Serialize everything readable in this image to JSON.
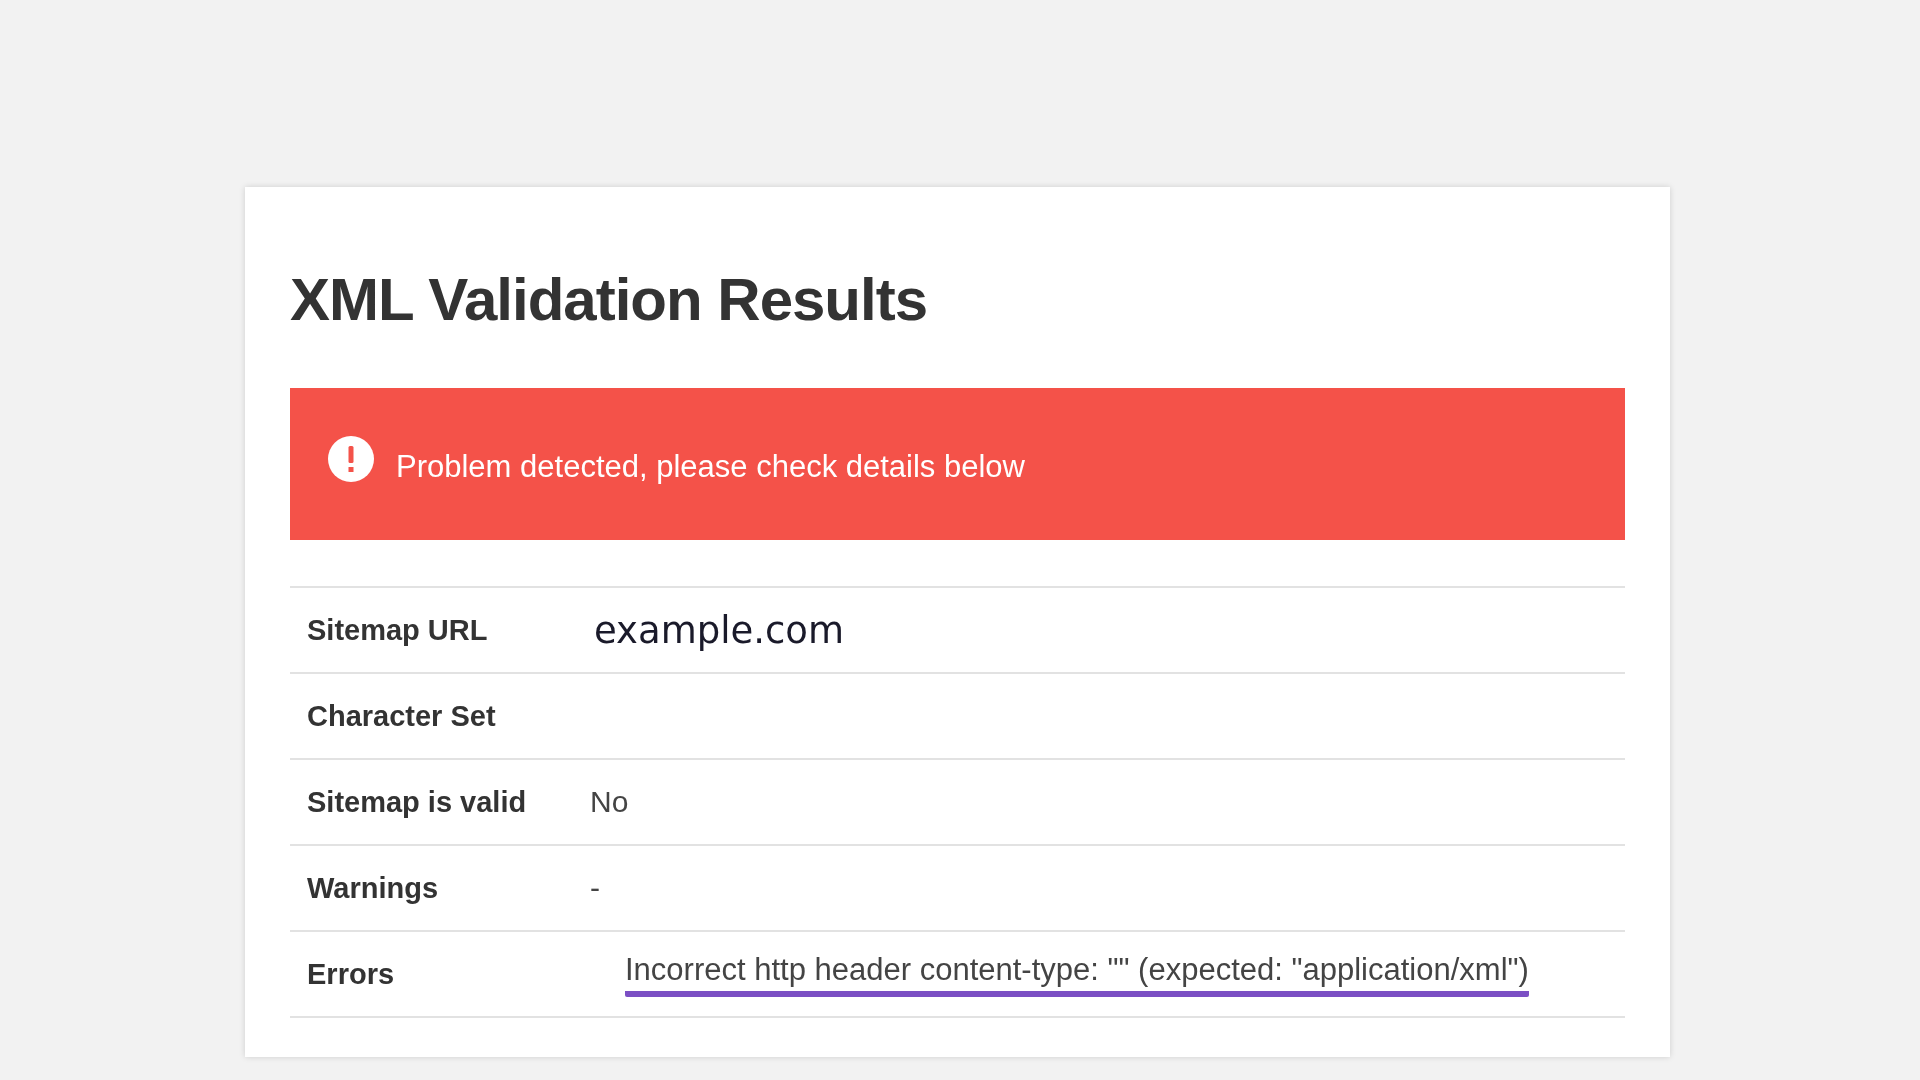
{
  "title": "XML Validation Results",
  "alert": {
    "kind": "error",
    "text": "Problem detected, please check details below"
  },
  "rows": [
    {
      "label": "Sitemap URL",
      "value": "example.com",
      "kind": "pasted",
      "underlined": false
    },
    {
      "label": "Character Set",
      "underlined": false
    },
    {
      "label": "Sitemap is valid",
      "value": "No",
      "kind": "text",
      "underlined": false
    },
    {
      "label": "Warnings",
      "value": "-",
      "kind": "text",
      "underlined": false
    },
    {
      "label": "Errors",
      "value": "Incorrect http header content-type: \"\" (expected: \"application/xml\")",
      "kind": "text",
      "underlined": true
    }
  ]
}
